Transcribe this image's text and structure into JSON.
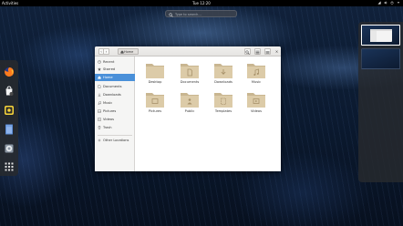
{
  "topbar": {
    "activities_label": "Activities",
    "clock": "Tue 12:20",
    "tray_icons": [
      "network-icon",
      "volume-icon",
      "power-icon",
      "menu-arrow-icon"
    ]
  },
  "search": {
    "placeholder": "Type to search…"
  },
  "dash": {
    "items": [
      "firefox-icon",
      "software-icon",
      "rhythmbox-icon",
      "files-icon",
      "help-icon",
      "show-apps-icon"
    ]
  },
  "files_window": {
    "nav": {
      "back": "‹",
      "forward": "›"
    },
    "path_label": "Home",
    "close_label": "×",
    "sidebar": [
      {
        "label": "Recent",
        "icon": "clock-icon"
      },
      {
        "label": "Starred",
        "icon": "star-icon"
      },
      {
        "label": "Home",
        "icon": "home-icon",
        "active": true
      },
      {
        "label": "Documents",
        "icon": "document-icon"
      },
      {
        "label": "Downloads",
        "icon": "download-icon"
      },
      {
        "label": "Music",
        "icon": "music-icon"
      },
      {
        "label": "Pictures",
        "icon": "picture-icon"
      },
      {
        "label": "Videos",
        "icon": "video-icon"
      },
      {
        "label": "Trash",
        "icon": "trash-icon"
      },
      {
        "label": "Other Locations",
        "icon": "plus-icon"
      }
    ],
    "folders": [
      {
        "label": "Desktop",
        "emblem": ""
      },
      {
        "label": "Documents",
        "emblem": "document"
      },
      {
        "label": "Downloads",
        "emblem": "download"
      },
      {
        "label": "Music",
        "emblem": "music"
      },
      {
        "label": "Pictures",
        "emblem": "picture"
      },
      {
        "label": "Public",
        "emblem": "share"
      },
      {
        "label": "Templates",
        "emblem": "template"
      },
      {
        "label": "Videos",
        "emblem": "video"
      }
    ],
    "accent_color": "#4a90d9",
    "folder_color": "#d9c8a9"
  }
}
